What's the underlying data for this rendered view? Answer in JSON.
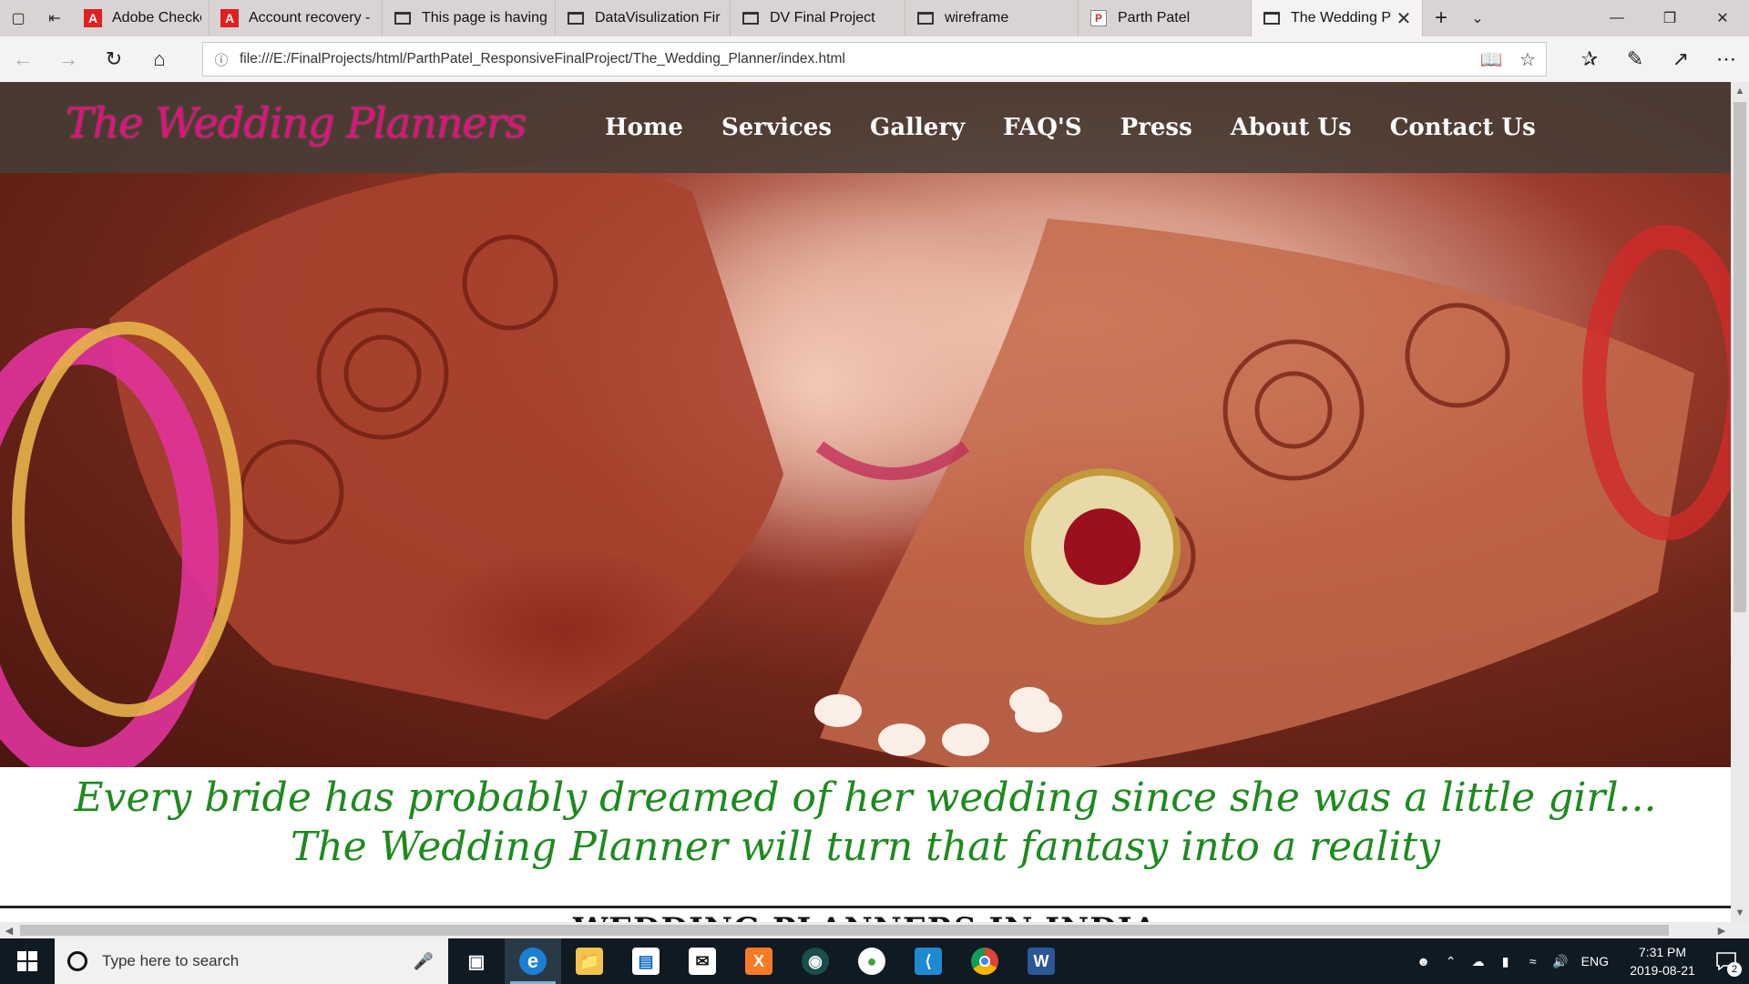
{
  "browser": {
    "tabs": [
      {
        "label": "Adobe Checkout",
        "icon": "adobe-icon",
        "active": false
      },
      {
        "label": "Account recovery -",
        "icon": "adobe-icon",
        "active": false
      },
      {
        "label": "This page is having",
        "icon": "page-icon",
        "active": false
      },
      {
        "label": "DataVisulization Fir",
        "icon": "page-icon",
        "active": false
      },
      {
        "label": "DV Final Project",
        "icon": "page-icon",
        "active": false
      },
      {
        "label": "wireframe",
        "icon": "page-icon",
        "active": false
      },
      {
        "label": "Parth Patel",
        "icon": "pp-icon",
        "active": false
      },
      {
        "label": "The Wedding P",
        "icon": "page-icon",
        "active": true
      }
    ],
    "url": "file:///E:/FinalProjects/html/ParthPatel_ResponsiveFinalProject/The_Wedding_Planner/index.html"
  },
  "site": {
    "brand": "The Wedding Planners",
    "nav": [
      "Home",
      "Services",
      "Gallery",
      "FAQ'S",
      "Press",
      "About Us",
      "Contact Us"
    ],
    "tagline_line1": "Every bride has probably dreamed of her wedding since she was a little girl...",
    "tagline_line2": "The Wedding Planner will turn that fantasy into a reality",
    "section_heading": "WEDDING PLANNERS IN INDIA"
  },
  "taskbar": {
    "search_placeholder": "Type here to search",
    "apps": [
      "edge",
      "file-explorer",
      "store",
      "mail",
      "xampp",
      "gitkraken",
      "mongodb",
      "vscode",
      "chrome",
      "word"
    ],
    "language": "ENG",
    "time": "7:31 PM",
    "date": "2019-08-21",
    "notifications": "2"
  },
  "colors": {
    "brand": "#e3107e",
    "tagline": "#1d8a1d",
    "header_bg": "#463e36"
  }
}
